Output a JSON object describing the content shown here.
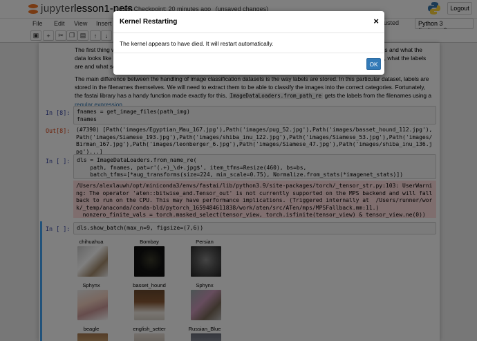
{
  "header": {
    "logo_text": "jupyter",
    "notebook_name": "lesson1-pets",
    "checkpoint": "Last Checkpoint: 20 minutes ago",
    "unsaved": "(unsaved changes)",
    "logout_label": "Logout"
  },
  "menubar": {
    "items": [
      "File",
      "Edit",
      "View",
      "Insert"
    ],
    "trusted": "usted",
    "kernel": "Python 3 (ipykernel)"
  },
  "toolbar": {
    "buttons": [
      "save-icon",
      "add-icon",
      "cut-icon",
      "copy-icon",
      "paste-icon",
      "arrow-up-icon",
      "arrow-down-icon"
    ]
  },
  "notebook": {
    "md1_left": "The first thing w",
    "md1_right": "e problem is and what the",
    "md2_left": "data looks like b",
    "md2_right": "are structured, what the labels",
    "md3_left": "are and what so",
    "md4": "The main difference between the handling of image classification datasets is the way labels are stored. In this particular dataset, labels are stored in the filenames themselves. We will need to extract them to be able to classify the images into the correct categories. Fortunately, the fastai library has a handy function made exactly for this,",
    "md4_code": "ImageDataLoaders.from_path_re",
    "md4_tail": "gets the labels from the filenames using a",
    "md4_link": "regular expression",
    "md4_end": ".",
    "cell1_prompt": "In [8]:",
    "cell1_line1": "fnames = get_image_files(path_img)",
    "cell1_line2": "fnames",
    "out1_prompt": "Out[8]:",
    "out1_text": "(#7390) [Path('images/Egyptian_Mau_167.jpg'),Path('images/pug_52.jpg'),Path('images/basset_hound_112.jpg'),Path('images/Siamese_193.jpg'),Path('images/shiba_inu_122.jpg'),Path('images/Siamese_53.jpg'),Path('images/Birman_167.jpg'),Path('images/leonberger_6.jpg'),Path('images/Siamese_47.jpg'),Path('images/shiba_inu_136.jpg')...]",
    "cell2_prompt": "In [ ]:",
    "cell2_line1": "dls = ImageDataLoaders.from_name_re(",
    "cell2_line2": "    path, fnames, pat=r'(.+)_\\d+.jpg$', item_tfms=Resize(460), bs=bs,",
    "cell2_line3": "    batch_tfms=[*aug_transforms(size=224, min_scale=0.75), Normalize.from_stats(*imagenet_stats)])",
    "stderr_text": "/Users/alexlauwh/opt/miniconda3/envs/fastai/lib/python3.9/site-packages/torch/_tensor_str.py:103: UserWarning: The operator 'aten::bitwise_and.Tensor_out' is not currently supported on the MPS backend and will fall back to run on the CPU. This may have performance implications. (Triggered internally at  /Users/runner/work/_temp/anaconda/conda-bld/pytorch_1659484611838/work/aten/src/ATen/mps/MPSFallback.mm:11.)\n  nonzero_finite_vals = torch.masked_select(tensor_view, torch.isfinite(tensor_view) & tensor_view.ne(0))",
    "cell3_prompt": "In [ ]:",
    "cell3_line1": "dls.show_batch(max_n=9, figsize=(7,6))",
    "grid_labels": [
      "chihuahua",
      "Bombay",
      "Persian",
      "Sphynx",
      "basset_hound",
      "Sphynx",
      "beagle",
      "english_setter",
      "Russian_Blue"
    ]
  },
  "modal": {
    "title": "Kernel Restarting",
    "close": "×",
    "body": "The kernel appears to have died. It will restart automatically.",
    "ok_label": "OK"
  }
}
